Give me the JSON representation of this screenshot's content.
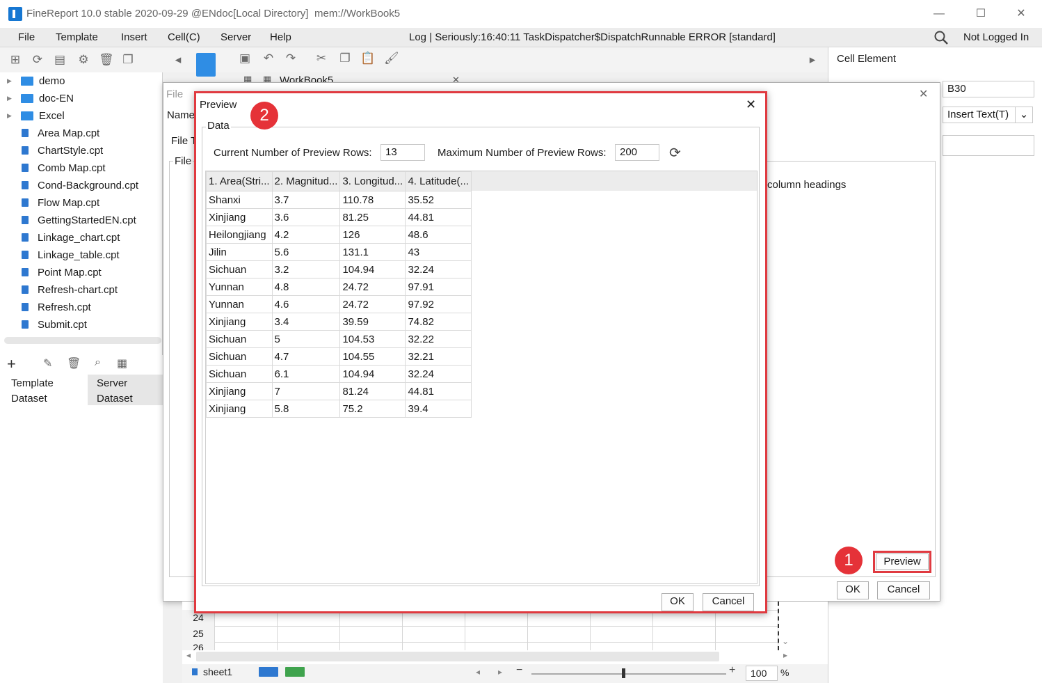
{
  "window": {
    "title": "FineReport 10.0 stable 2020-09-29 @ENdoc[Local Directory]",
    "path": "mem://WorkBook5",
    "minimize": "—",
    "maximize": "☐",
    "close": "✕"
  },
  "menu": {
    "items": [
      "File",
      "Template",
      "Insert",
      "Cell(C)",
      "Server",
      "Help"
    ],
    "log": "Log | Seriously:16:40:11 TaskDispatcher$DispatchRunnable ERROR [standard]",
    "user": "Not Logged In"
  },
  "tree": {
    "folders": [
      "demo",
      "doc-EN",
      "Excel"
    ],
    "files": [
      "Area Map.cpt",
      "ChartStyle.cpt",
      "Comb Map.cpt",
      "Cond-Background.cpt",
      "Flow Map.cpt",
      "GettingStartedEN.cpt",
      "Linkage_chart.cpt",
      "Linkage_table.cpt",
      "Point Map.cpt",
      "Refresh-chart.cpt",
      "Refresh.cpt",
      "Submit.cpt"
    ]
  },
  "dataset_tabs": {
    "template": "Template Dataset",
    "server": "Server Dataset"
  },
  "editor": {
    "tab": "WorkBook5",
    "rows": [
      "24",
      "25",
      "26"
    ],
    "sheet": "sheet1",
    "zoom": "100",
    "zoom_unit": "%"
  },
  "right_panel": {
    "title": "Cell Element",
    "cell": "B30",
    "insert": "Insert Text(T)"
  },
  "bg_dialog": {
    "file_label": "File",
    "name_label": "Name",
    "file_type_label": "File T",
    "file_group_label": "File",
    "column_headings": "column headings",
    "preview_button": "Preview",
    "ok": "OK",
    "cancel": "Cancel"
  },
  "preview": {
    "title": "Preview",
    "group": "Data",
    "current_rows_label": "Current Number of Preview Rows:",
    "current_rows": "13",
    "max_rows_label": "Maximum Number of Preview Rows:",
    "max_rows": "200",
    "columns": [
      "1. Area(Stri...",
      "2. Magnitud...",
      "3. Longitud...",
      "4. Latitude(..."
    ],
    "rows": [
      [
        "Shanxi",
        "3.7",
        "110.78",
        "35.52"
      ],
      [
        "Xinjiang",
        "3.6",
        "81.25",
        "44.81"
      ],
      [
        "Heilongjiang",
        "4.2",
        "126",
        "48.6"
      ],
      [
        "Jilin",
        "5.6",
        "131.1",
        "43"
      ],
      [
        "Sichuan",
        "3.2",
        "104.94",
        "32.24"
      ],
      [
        "Yunnan",
        "4.8",
        "24.72",
        "97.91"
      ],
      [
        "Yunnan",
        "4.6",
        "24.72",
        "97.92"
      ],
      [
        "Xinjiang",
        "3.4",
        "39.59",
        "74.82"
      ],
      [
        "Sichuan",
        "5",
        "104.53",
        "32.22"
      ],
      [
        "Sichuan",
        "4.7",
        "104.55",
        "32.21"
      ],
      [
        "Sichuan",
        "6.1",
        "104.94",
        "32.24"
      ],
      [
        "Xinjiang",
        "7",
        "81.24",
        "44.81"
      ],
      [
        "Xinjiang",
        "5.8",
        "75.2",
        "39.4"
      ]
    ],
    "ok": "OK",
    "cancel": "Cancel"
  },
  "badges": {
    "one": "1",
    "two": "2"
  },
  "colors": {
    "accent": "#1677d2",
    "highlight": "#e03a40"
  }
}
